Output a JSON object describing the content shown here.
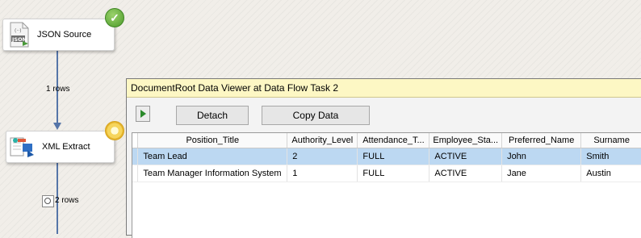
{
  "canvas": {
    "json_source": {
      "label": "JSON Source",
      "icon": "json-file-icon",
      "status_icon": "checkmark-icon",
      "status_color": "#4c9a2a"
    },
    "path1_label": "1 rows",
    "xml_extract": {
      "label": "XML Extract",
      "icon": "xml-extract-icon",
      "status_icon": "running-icon",
      "status_color": "#f6d55c"
    },
    "path2_label": "2 rows",
    "path_color": "#5575a8"
  },
  "viewer": {
    "title": "DocumentRoot Data Viewer at Data Flow Task 2",
    "title_bg": "#fdf7c4",
    "toolbar": {
      "play_icon": "play-icon",
      "detach_label": "Detach",
      "copy_label": "Copy Data"
    },
    "columns": [
      "Position_Title",
      "Authority_Level",
      "Attendance_T...",
      "Employee_Sta...",
      "Preferred_Name",
      "Surname"
    ],
    "rows": [
      [
        "Team Lead",
        "2",
        "FULL",
        "ACTIVE",
        "John",
        "Smith"
      ],
      [
        "Team Manager Information System",
        "1",
        "FULL",
        "ACTIVE",
        "Jane",
        "Austin"
      ]
    ],
    "selected_row": 0,
    "selection_color": "#bcd8f2"
  }
}
